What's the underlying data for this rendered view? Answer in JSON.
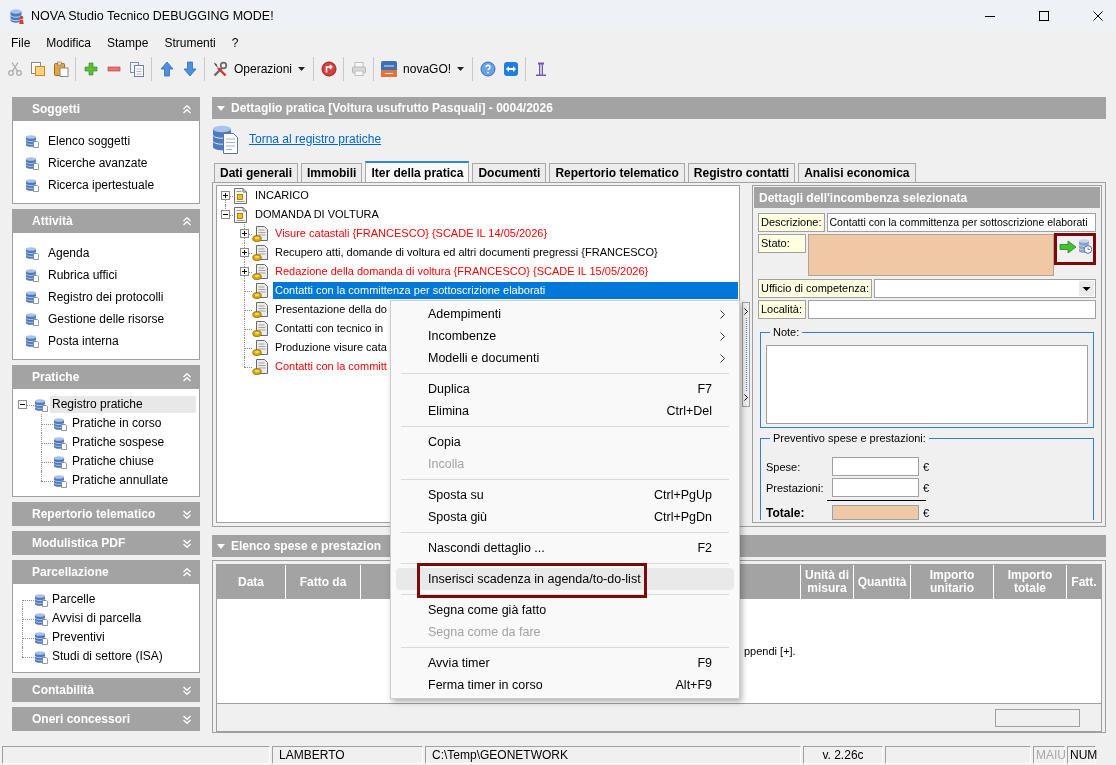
{
  "window": {
    "title": "NOVA Studio Tecnico DEBUGGING MODE!"
  },
  "menu_bar": [
    "File",
    "Modifica",
    "Stampe",
    "Strumenti",
    "?"
  ],
  "toolbar": {
    "groups": [
      [
        {
          "kind": "icon",
          "disabled": true
        },
        {
          "kind": "icon",
          "disabled": false
        },
        {
          "kind": "icon",
          "disabled": false
        }
      ],
      [
        {
          "kind": "icon",
          "disabled": false
        },
        {
          "kind": "icon",
          "disabled": false
        },
        {
          "kind": "icon",
          "disabled": false
        }
      ],
      [
        {
          "kind": "icon",
          "disabled": false
        },
        {
          "kind": "icon",
          "disabled": false
        }
      ],
      [
        {
          "kind": "menu",
          "label": "Operazioni",
          "disabled": false
        }
      ],
      [
        {
          "kind": "icon",
          "disabled": false
        }
      ],
      [
        {
          "kind": "icon",
          "disabled": true
        }
      ],
      [
        {
          "kind": "menu",
          "label": "novaGO!",
          "disabled": false
        }
      ],
      [
        {
          "kind": "icon",
          "disabled": false
        },
        {
          "kind": "icon",
          "disabled": false
        }
      ],
      [
        {
          "kind": "icon",
          "disabled": false
        }
      ]
    ]
  },
  "sidebar": {
    "panels": [
      {
        "title": "Soggetti",
        "expanded": true,
        "kind": "list",
        "items": [
          {
            "label": "Elenco soggetti",
            "selected": false
          },
          {
            "label": "Ricerche avanzate",
            "selected": false
          },
          {
            "label": "Ricerca ipertestuale",
            "selected": false
          }
        ]
      },
      {
        "title": "Attività",
        "expanded": true,
        "kind": "list",
        "items": [
          {
            "label": "Agenda",
            "selected": false
          },
          {
            "label": "Rubrica uffici",
            "selected": false
          },
          {
            "label": "Registro dei protocolli",
            "selected": false
          },
          {
            "label": "Gestione delle risorse",
            "selected": false
          },
          {
            "label": "Posta interna",
            "selected": false
          }
        ]
      },
      {
        "title": "Pratiche",
        "expanded": true,
        "kind": "tree",
        "items": [
          {
            "label": "Registro pratiche",
            "selected": true,
            "expanded": true,
            "children": [
              {
                "label": "Pratiche in corso",
                "selected": false
              },
              {
                "label": "Pratiche sospese",
                "selected": false
              },
              {
                "label": "Pratiche chiuse",
                "selected": false
              },
              {
                "label": "Pratiche annullate",
                "selected": false
              }
            ]
          }
        ]
      },
      {
        "title": "Repertorio telematico",
        "expanded": false
      },
      {
        "title": "Modulistica PDF",
        "expanded": false
      },
      {
        "title": "Parcellazione",
        "expanded": true,
        "kind": "tree",
        "items": [
          {
            "label": "Parcelle",
            "selected": false
          },
          {
            "label": "Avvisi di parcella",
            "selected": false
          },
          {
            "label": "Preventivi",
            "selected": false
          },
          {
            "label": "Studi di settore (ISA)",
            "selected": false
          }
        ]
      },
      {
        "title": "Contabilità",
        "expanded": false
      },
      {
        "title": "Oneri concessori",
        "expanded": false
      }
    ]
  },
  "detail": {
    "title": "Dettaglio pratica [Voltura usufrutto Pasquali] - 0004/2026",
    "expanded": true,
    "back_link": "Torna al registro pratiche",
    "tabs": [
      {
        "label": "Dati generali",
        "selected": false
      },
      {
        "label": "Immobili",
        "selected": false
      },
      {
        "label": "Iter della pratica",
        "selected": true
      },
      {
        "label": "Documenti",
        "selected": false
      },
      {
        "label": "Repertorio telematico",
        "selected": false
      },
      {
        "label": "Registro contatti",
        "selected": false
      },
      {
        "label": "Analisi economica",
        "selected": false
      }
    ],
    "tree": [
      {
        "label": "INCARICO",
        "expanded": false,
        "selected": false,
        "overdue": false
      },
      {
        "label": "DOMANDA DI VOLTURA",
        "expanded": true,
        "selected": false,
        "overdue": false,
        "children": [
          {
            "label": "Visure catastali {FRANCESCO} {SCADE IL 14/05/2026}",
            "expanded": false,
            "selected": false,
            "overdue": true
          },
          {
            "label": "Recupero atti, domande di voltura ed altri documenti pregressi {FRANCESCO}",
            "expanded": false,
            "selected": false,
            "overdue": false
          },
          {
            "label": "Redazione della domanda di voltura {FRANCESCO} {SCADE IL 15/05/2026}",
            "expanded": false,
            "selected": false,
            "overdue": true
          },
          {
            "label": "Contatti con la committenza per sottoscrizione elaborati",
            "selected": true,
            "overdue": false
          },
          {
            "label": "Presentazione della do",
            "selected": false,
            "overdue": false
          },
          {
            "label": "Contatti con tecnico in",
            "selected": false,
            "overdue": false
          },
          {
            "label": "Produzione visure cata",
            "selected": false,
            "overdue": false
          },
          {
            "label": "Contatti con la committ",
            "selected": false,
            "overdue": true
          }
        ]
      }
    ],
    "context_menu": {
      "items": [
        {
          "kind": "item",
          "label": "Adempimenti",
          "submenu": true,
          "disabled": false,
          "selected": false,
          "framed": false
        },
        {
          "kind": "item",
          "label": "Incombenze",
          "submenu": true,
          "disabled": false,
          "selected": false,
          "framed": false
        },
        {
          "kind": "item",
          "label": "Modelli e documenti",
          "submenu": true,
          "disabled": false,
          "selected": false,
          "framed": false
        },
        {
          "kind": "separator"
        },
        {
          "kind": "item",
          "label": "Duplica",
          "shortcut": "F7",
          "submenu": false,
          "disabled": false,
          "selected": false,
          "framed": false
        },
        {
          "kind": "item",
          "label": "Elimina",
          "shortcut": "Ctrl+Del",
          "submenu": false,
          "disabled": false,
          "selected": false,
          "framed": false
        },
        {
          "kind": "separator"
        },
        {
          "kind": "item",
          "label": "Copia",
          "submenu": false,
          "disabled": false,
          "selected": false,
          "framed": false
        },
        {
          "kind": "item",
          "label": "Incolla",
          "submenu": false,
          "disabled": true,
          "selected": false,
          "framed": false
        },
        {
          "kind": "separator"
        },
        {
          "kind": "item",
          "label": "Sposta su",
          "shortcut": "Ctrl+PgUp",
          "submenu": false,
          "disabled": false,
          "selected": false,
          "framed": false
        },
        {
          "kind": "item",
          "label": "Sposta giù",
          "shortcut": "Ctrl+PgDn",
          "submenu": false,
          "disabled": false,
          "selected": false,
          "framed": false
        },
        {
          "kind": "separator"
        },
        {
          "kind": "item",
          "label": "Nascondi dettaglio ...",
          "shortcut": "F2",
          "submenu": false,
          "disabled": false,
          "selected": false,
          "framed": false
        },
        {
          "kind": "separator"
        },
        {
          "kind": "item",
          "label": "Inserisci scadenza in agenda/to-do-list",
          "submenu": false,
          "disabled": false,
          "selected": true,
          "framed": true
        },
        {
          "kind": "separator"
        },
        {
          "kind": "item",
          "label": "Segna come già fatto",
          "submenu": false,
          "disabled": false,
          "selected": false,
          "framed": false
        },
        {
          "kind": "item",
          "label": "Segna come da fare",
          "submenu": false,
          "disabled": true,
          "selected": false,
          "framed": false
        },
        {
          "kind": "separator"
        },
        {
          "kind": "item",
          "label": "Avvia timer",
          "shortcut": "F9",
          "submenu": false,
          "disabled": false,
          "selected": false,
          "framed": false
        },
        {
          "kind": "item",
          "label": "Ferma timer in corso",
          "shortcut": "Alt+F9",
          "submenu": false,
          "disabled": false,
          "selected": false,
          "framed": false
        }
      ]
    },
    "incombenza": {
      "title": "Dettagli dell'incombenza selezionata",
      "description": {
        "label": "Descrizione:",
        "value": "Contatti con la committenza per sottoscrizione elaborati"
      },
      "status": {
        "label": "Stato:",
        "actions_framed": true
      },
      "office": {
        "label": "Ufficio di competenza:"
      },
      "locality": {
        "label": "Località:"
      },
      "notes": {
        "label": "Note:"
      },
      "estimate": {
        "title": "Preventivo spese e prestazioni:",
        "rows": [
          {
            "kind": "amount",
            "label": "Spese:",
            "currency": "€"
          },
          {
            "kind": "amount",
            "label": "Prestazioni:",
            "currency": "€"
          },
          {
            "kind": "total",
            "label": "Totale:",
            "currency": "€"
          }
        ]
      }
    }
  },
  "expenses": {
    "title": "Elenco spese e prestazion",
    "expanded": true,
    "columns": [
      "Data",
      "Fatto da",
      "Unità di misura",
      "Quantità",
      "Importo unitario",
      "Importo totale",
      "Fatt."
    ],
    "empty_message": "ppendi [+]."
  },
  "status_bar": {
    "user": "LAMBERTO",
    "path": "C:\\Temp\\GEONETWORK",
    "version": "v. 2.26c",
    "indicators": [
      {
        "label": "MAIU",
        "on": false
      },
      {
        "label": "NUM",
        "on": true
      }
    ]
  }
}
